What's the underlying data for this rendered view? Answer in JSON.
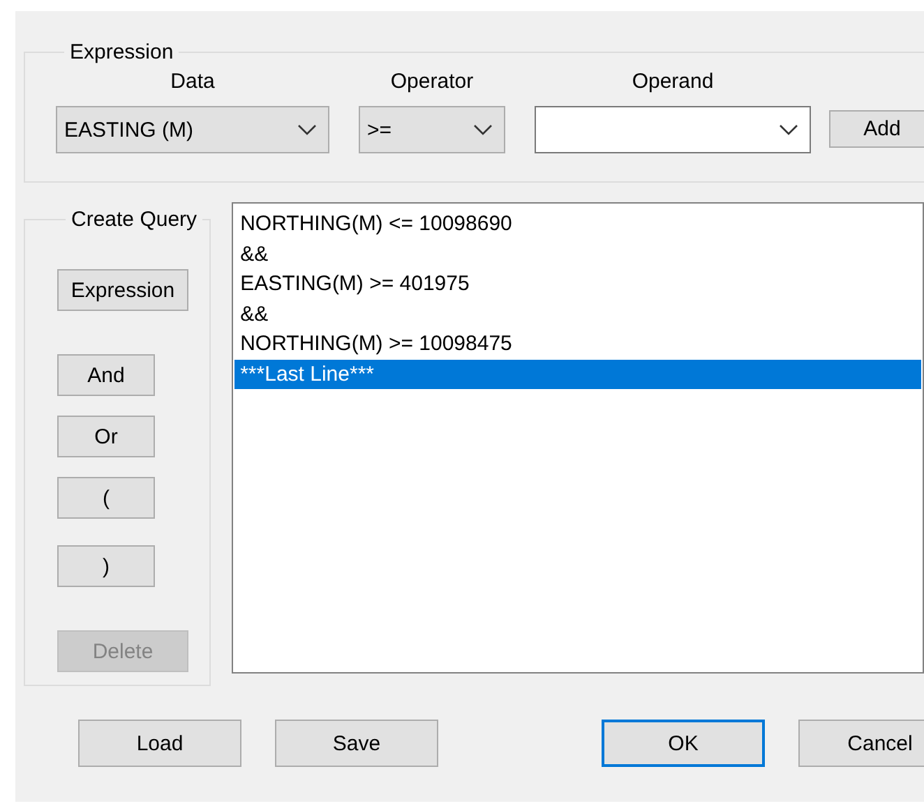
{
  "expression": {
    "title": "Expression",
    "fields": [
      {
        "kind": "dropdown",
        "label": "Data",
        "value": "EASTING (M)"
      },
      {
        "kind": "dropdown",
        "label": "Operator",
        "value": ">="
      },
      {
        "kind": "editable",
        "label": "Operand"
      }
    ],
    "add_button": "Add"
  },
  "create_query": {
    "title": "Create Query",
    "buttons": [
      {
        "label": "Expression",
        "disabled": false
      },
      {
        "label": "And",
        "disabled": false
      },
      {
        "label": "Or",
        "disabled": false
      },
      {
        "label": "(",
        "disabled": false
      },
      {
        "label": ")",
        "disabled": false
      },
      {
        "label": "Delete",
        "disabled": true
      }
    ],
    "lines": [
      {
        "text": "NORTHING(M) <= 10098690",
        "selected": false
      },
      {
        "text": "&&",
        "selected": false
      },
      {
        "text": "EASTING(M) >= 401975",
        "selected": false
      },
      {
        "text": "&&",
        "selected": false
      },
      {
        "text": "NORTHING(M) >= 10098475",
        "selected": false
      },
      {
        "text": "***Last Line***",
        "selected": true
      }
    ]
  },
  "buttons": [
    {
      "label": "Load",
      "default": false
    },
    {
      "label": "Save",
      "default": false
    },
    {
      "label": "OK",
      "default": true
    },
    {
      "label": "Cancel",
      "default": false
    }
  ]
}
